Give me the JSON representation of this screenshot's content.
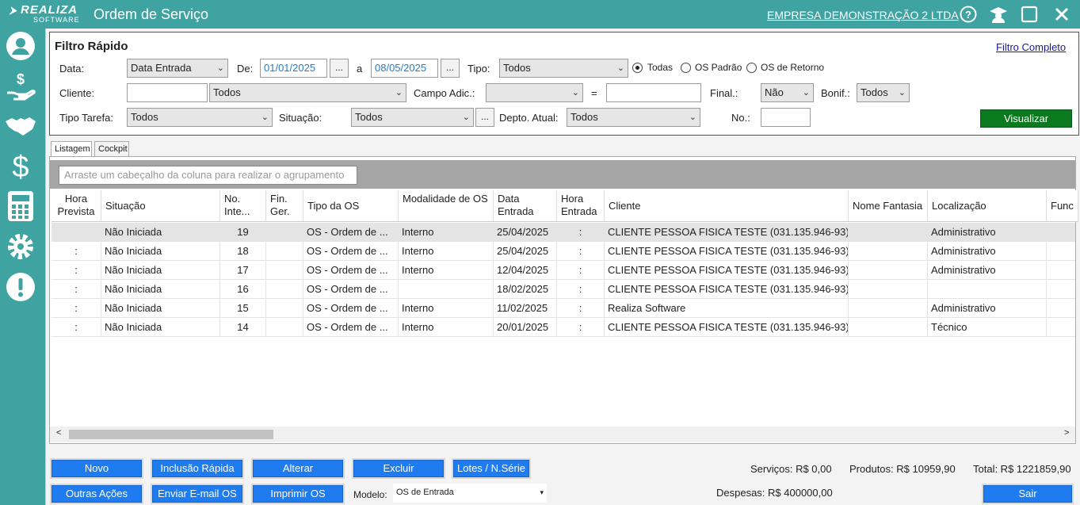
{
  "header": {
    "logo_main": "REALIZA",
    "logo_sub": "SOFTWARE",
    "title": "Ordem de Serviço",
    "company": "EMPRESA DEMONSTRAÇÃO 2 LTDA"
  },
  "filter": {
    "title": "Filtro Rápido",
    "full_link": "Filtro Completo",
    "data_label": "Data:",
    "data_value": "Data Entrada",
    "de_label": "De:",
    "de_value": "01/01/2025",
    "a_label": "a",
    "a_value": "08/05/2025",
    "tipo_label": "Tipo:",
    "tipo_value": "Todos",
    "radio_all": "Todas",
    "radio_padrao": "OS Padrão",
    "radio_retorno": "OS de Retorno",
    "cliente_label": "Cliente:",
    "cliente_code": "",
    "cliente_value": "Todos",
    "campo_label": "Campo Adic.:",
    "campo_value": "",
    "eq": "=",
    "campo_text": "",
    "final_label": "Final.:",
    "final_value": "Não",
    "bonif_label": "Bonif.:",
    "bonif_value": "Todos",
    "tarefa_label": "Tipo Tarefa:",
    "tarefa_value": "Todos",
    "situacao_label": "Situação:",
    "situacao_value": "Todos",
    "depto_label": "Depto. Atual:",
    "depto_value": "Todos",
    "no_label": "No.:",
    "no_value": "",
    "dots": "...",
    "visualizar": "Visualizar"
  },
  "tabs": [
    "Listagem",
    "Cockpit"
  ],
  "grid": {
    "group_placeholder": "Arraste um cabeçalho da coluna para realizar o agrupamento",
    "columns": [
      {
        "label": "Hora Prevista"
      },
      {
        "label": "Situação"
      },
      {
        "label": "No. Inte..."
      },
      {
        "label": "Fin. Ger."
      },
      {
        "label": "Tipo da OS"
      },
      {
        "label": "Modalidade de OS"
      },
      {
        "label": "Data Entrada"
      },
      {
        "label": "Hora Entrada"
      },
      {
        "label": "Cliente"
      },
      {
        "label": "Nome Fantasia"
      },
      {
        "label": "Localização"
      },
      {
        "label": "Func"
      }
    ],
    "rows": [
      [
        "",
        "Não Iniciada",
        "19",
        "",
        "OS - Ordem de ...",
        "Interno",
        "25/04/2025",
        ":",
        "CLIENTE PESSOA FISICA TESTE (031.135.946-93)",
        "",
        "Administrativo"
      ],
      [
        ":",
        "Não Iniciada",
        "18",
        "",
        "OS - Ordem de ...",
        "Interno",
        "25/04/2025",
        ":",
        "CLIENTE PESSOA FISICA TESTE (031.135.946-93)",
        "",
        "Administrativo"
      ],
      [
        ":",
        "Não Iniciada",
        "17",
        "",
        "OS - Ordem de ...",
        "Interno",
        "12/04/2025",
        ":",
        "CLIENTE PESSOA FISICA TESTE (031.135.946-93)",
        "",
        "Administrativo"
      ],
      [
        ":",
        "Não Iniciada",
        "16",
        "",
        "OS - Ordem de ...",
        "",
        "18/02/2025",
        ":",
        "CLIENTE PESSOA FISICA TESTE (031.135.946-93)",
        "",
        ""
      ],
      [
        ":",
        "Não Iniciada",
        "15",
        "",
        "OS - Ordem de ...",
        "Interno",
        "11/02/2025",
        ":",
        "Realiza Software",
        "",
        "Administrativo"
      ],
      [
        ":",
        "Não Iniciada",
        "14",
        "",
        "OS - Ordem de ...",
        "Interno",
        "20/01/2025",
        ":",
        "CLIENTE PESSOA FISICA TESTE (031.135.946-93)",
        "",
        "Técnico"
      ]
    ]
  },
  "buttons": {
    "novo": "Novo",
    "inclusao": "Inclusão Rápida",
    "alterar": "Alterar",
    "excluir": "Excluir",
    "lotes": "Lotes / N.Série",
    "outras": "Outras Ações",
    "email": "Enviar E-mail OS",
    "imprimir": "Imprimir OS",
    "sair": "Sair"
  },
  "modelo": {
    "label": "Modelo:",
    "value": "OS de Entrada"
  },
  "totals": {
    "servicos": "Serviços: R$ 0,00",
    "produtos": "Produtos: R$ 10959,90",
    "total": "Total: R$ 1221859,90",
    "despesas": "Despesas: R$ 400000,00"
  },
  "colors": {
    "teal": "#3ea3a1",
    "button_blue": "#1e7cf0",
    "green": "#0b7a1f"
  },
  "icons": {
    "sidebar": [
      "user-icon",
      "money-hand-icon",
      "handshake-icon",
      "dollar-icon",
      "calculator-icon",
      "gear-icon",
      "alert-icon"
    ],
    "topbar": [
      "help-icon",
      "graduation-icon",
      "maximize-icon",
      "close-icon"
    ]
  }
}
